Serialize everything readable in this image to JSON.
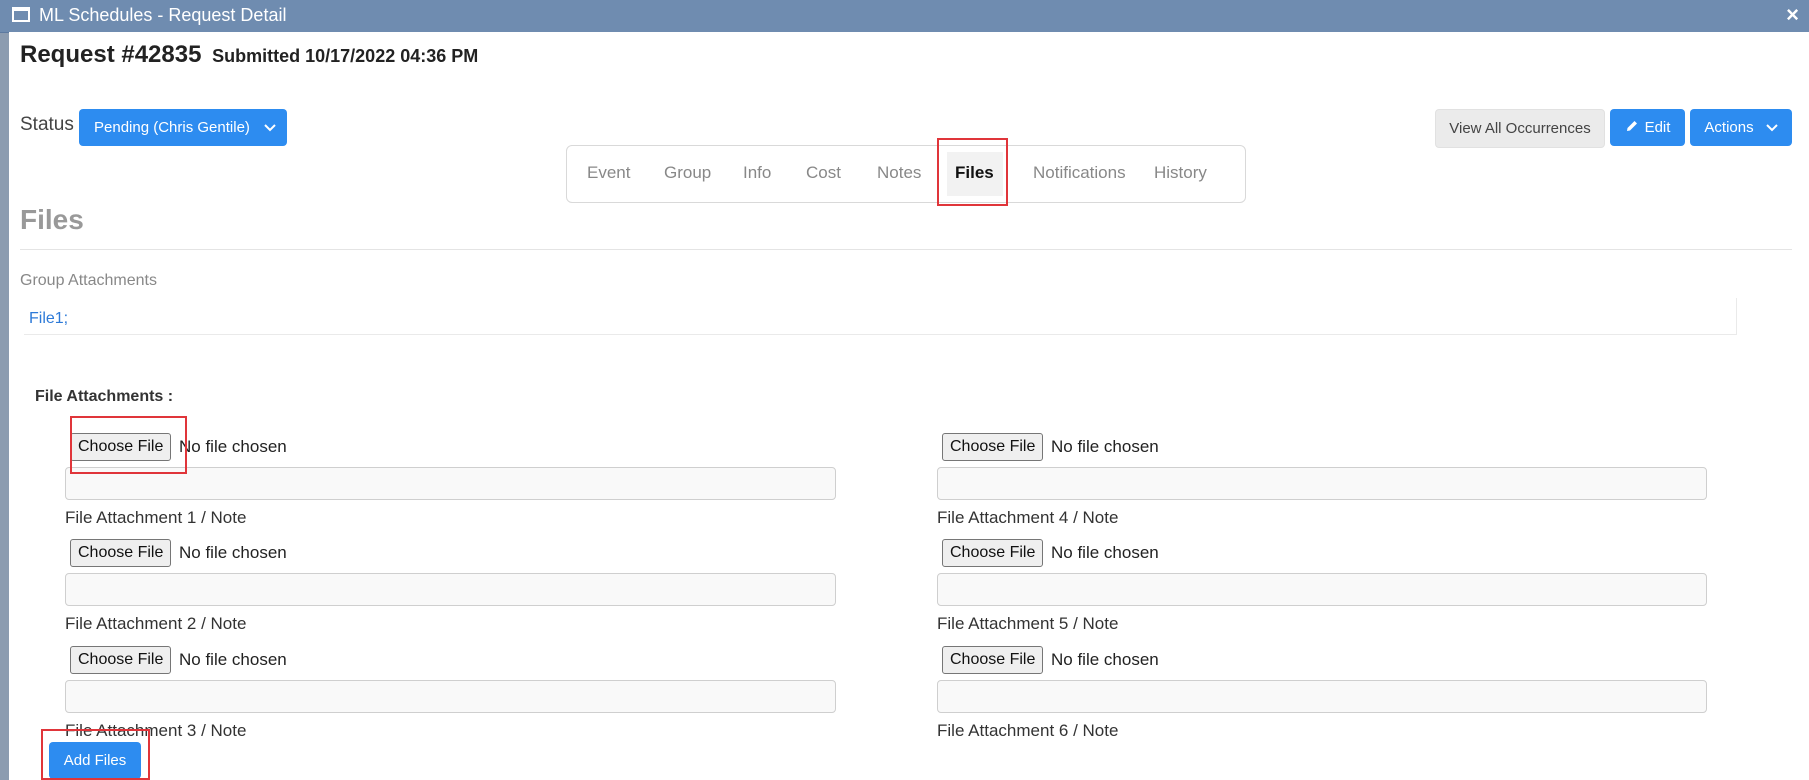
{
  "window": {
    "title": "ML Schedules - Request Detail",
    "close": "×"
  },
  "header": {
    "request": "Request #42835",
    "submitted": "Submitted 10/17/2022 04:36 PM"
  },
  "status": {
    "label": "Status",
    "value": "Pending (Chris Gentile)"
  },
  "toolbar": {
    "view_all": "View All Occurrences",
    "edit": "Edit",
    "actions": "Actions"
  },
  "tabs": [
    "Event",
    "Group",
    "Info",
    "Cost",
    "Notes",
    "Files",
    "Notifications",
    "History"
  ],
  "active_tab": "Files",
  "section": {
    "title": "Files",
    "group_label": "Group Attachments",
    "group_files": "File1;"
  },
  "attachments": {
    "label": "File Attachments :",
    "choose_label": "Choose File",
    "no_file": "No file chosen",
    "notes": [
      "File Attachment 1 / Note",
      "File Attachment 2 / Note",
      "File Attachment 3 / Note",
      "File Attachment 4 / Note",
      "File Attachment 5 / Note",
      "File Attachment 6 / Note"
    ]
  },
  "add_files": "Add Files",
  "colors": {
    "primary": "#2d8cf0",
    "highlight": "#e0353a",
    "link": "#2d7ad8"
  }
}
